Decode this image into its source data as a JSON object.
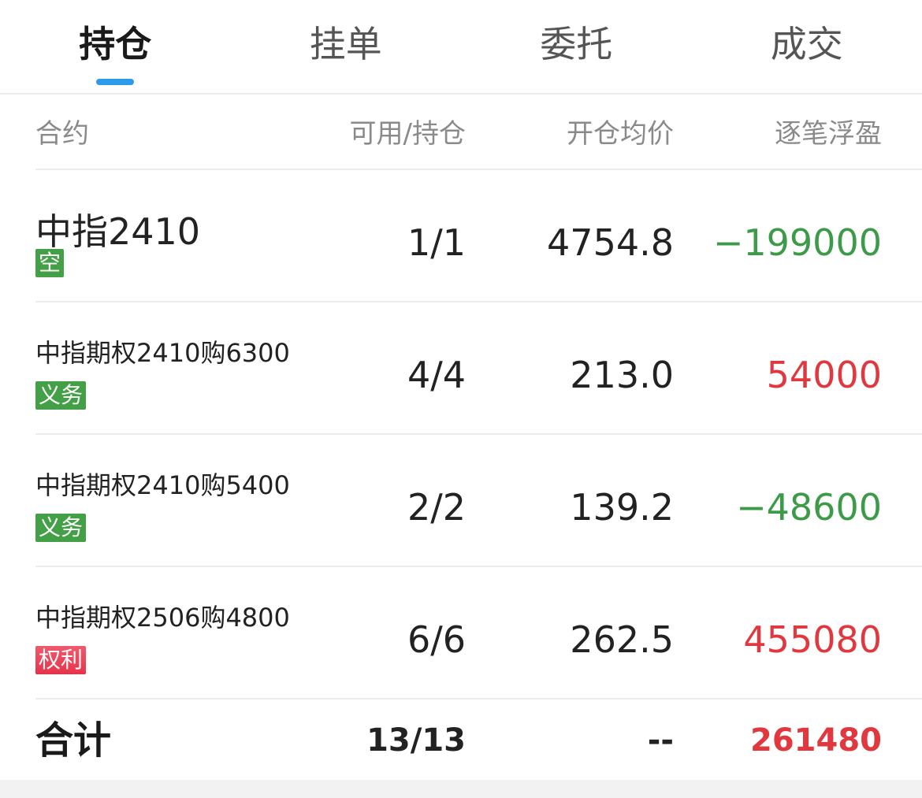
{
  "tabs": [
    {
      "label": "持仓",
      "active": true
    },
    {
      "label": "挂单",
      "active": false
    },
    {
      "label": "委托",
      "active": false
    },
    {
      "label": "成交",
      "active": false
    }
  ],
  "columns": {
    "contract": "合约",
    "available_position": "可用/持仓",
    "avg_open_price": "开仓均价",
    "pnl": "逐笔浮盈"
  },
  "rows": [
    {
      "contract": "中指2410",
      "tag": "空",
      "available_position": "1/1",
      "avg_open_price": "4754.8",
      "pnl": "−199000"
    },
    {
      "contract": "中指期权2410购6300",
      "tag": "义务",
      "available_position": "4/4",
      "avg_open_price": "213.0",
      "pnl": "54000"
    },
    {
      "contract": "中指期权2410购5400",
      "tag": "义务",
      "available_position": "2/2",
      "avg_open_price": "139.2",
      "pnl": "−48600"
    },
    {
      "contract": "中指期权2506购4800",
      "tag": "权利",
      "available_position": "6/6",
      "avg_open_price": "262.5",
      "pnl": "455080"
    }
  ],
  "total": {
    "label": "合计",
    "available_position": "13/13",
    "avg_open_price": "--",
    "pnl": "261480"
  },
  "colors": {
    "tab_indicator": "#2e9bea",
    "profit": "#e0383e",
    "loss": "#3d9a49",
    "tag_short_obligation": "#43a047",
    "tag_right": "#e6334a"
  }
}
